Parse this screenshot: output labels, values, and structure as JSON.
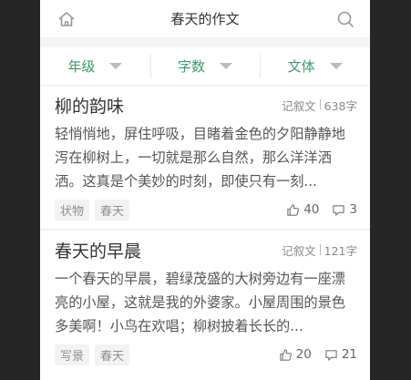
{
  "header": {
    "title": "春天的作文"
  },
  "filters": [
    {
      "label": "年级"
    },
    {
      "label": "字数"
    },
    {
      "label": "文体"
    }
  ],
  "articles": [
    {
      "title": "柳的韵味",
      "type": "记叙文",
      "words": "638字",
      "excerpt": "轻悄悄地，屏住呼吸，目睹着金色的夕阳静静地泻在柳树上，一切就是那么自然，那么洋洋洒洒。这真是个美妙的时刻，即使只有一刻...",
      "tags": [
        "状物",
        "春天"
      ],
      "likes": "40",
      "comments": "3"
    },
    {
      "title": "春天的早晨",
      "type": "记叙文",
      "words": "121字",
      "excerpt": "一个春天的早晨，碧绿茂盛的大树旁边有一座漂亮的小屋，这就是我的外婆家。小屋周围的景色多美啊！小鸟在欢唱；柳树披着长长的...",
      "tags": [
        "写景",
        "春天"
      ],
      "likes": "20",
      "comments": "21"
    }
  ],
  "colors": {
    "accent": "#3f9a68",
    "background": "#262626"
  },
  "icons": [
    "home-icon",
    "search-icon",
    "caret-down-icon",
    "thumbs-up-icon",
    "comment-icon"
  ]
}
